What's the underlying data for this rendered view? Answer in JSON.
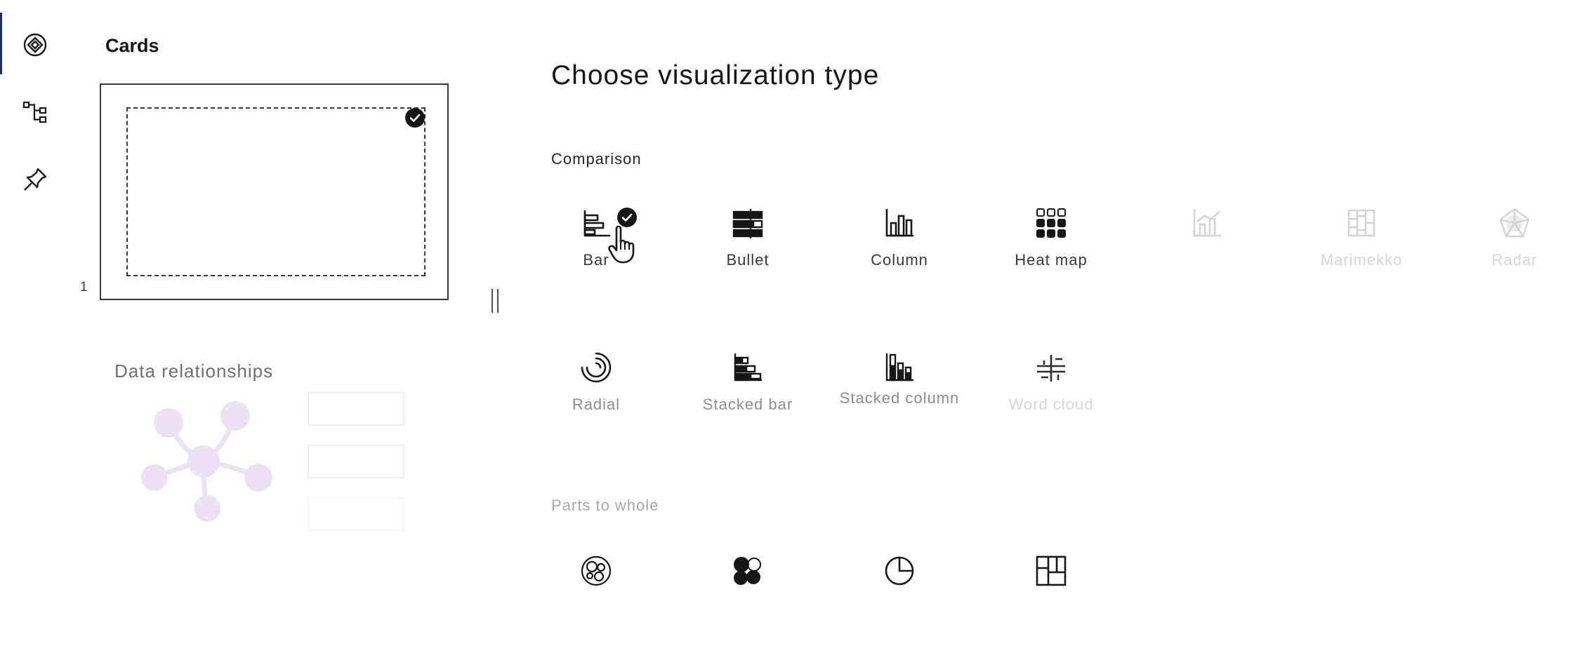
{
  "panel": {
    "title": "Cards",
    "card_number": "1",
    "data_relationships_title": "Data relationships"
  },
  "main": {
    "title": "Choose visualization type",
    "sections": [
      {
        "label": "Comparison",
        "items": [
          {
            "label": "Bar",
            "icon": "bar-chart-icon",
            "selected": true
          },
          {
            "label": "Bullet",
            "icon": "bullet-chart-icon"
          },
          {
            "label": "Column",
            "icon": "column-chart-icon"
          },
          {
            "label": "Heat map",
            "icon": "heat-map-icon"
          },
          {
            "label": "",
            "icon": "combination-chart-icon",
            "disabled": true
          },
          {
            "label": "Marimekko",
            "icon": "marimekko-icon",
            "disabled": true
          },
          {
            "label": "Radar",
            "icon": "radar-chart-icon",
            "disabled": true
          },
          {
            "label": "Radial",
            "icon": "radial-chart-icon"
          },
          {
            "label": "Stacked bar",
            "icon": "stacked-bar-icon"
          },
          {
            "label": "Stacked column",
            "icon": "stacked-column-icon"
          },
          {
            "label": "Word cloud",
            "icon": "word-cloud-icon",
            "disabled": true
          }
        ]
      },
      {
        "label": "Parts to whole",
        "items": [
          {
            "label": "",
            "icon": "packed-bubble-icon"
          },
          {
            "label": "",
            "icon": "hierarchy-bubble-icon"
          },
          {
            "label": "",
            "icon": "pie-chart-icon"
          },
          {
            "label": "",
            "icon": "treemap-icon"
          }
        ]
      }
    ]
  },
  "colors": {
    "accent": "#1f2a6b",
    "text": "#161616",
    "muted": "#8d8d8d",
    "faint_purple": "#d4b5e8"
  }
}
